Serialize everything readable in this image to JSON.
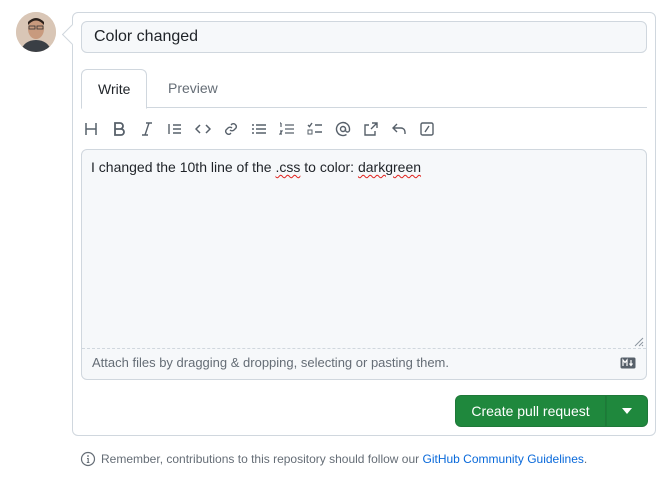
{
  "comment": {
    "title_value": "Color changed",
    "tabs": [
      {
        "label": "Write",
        "active": true
      },
      {
        "label": "Preview",
        "active": false
      }
    ],
    "toolbar_icons": [
      "heading-icon",
      "bold-icon",
      "italic-icon",
      "quote-icon",
      "code-icon",
      "link-icon",
      "unordered-list-icon",
      "ordered-list-icon",
      "task-list-icon",
      "mention-icon",
      "cross-reference-icon",
      "reply-icon",
      "slash-command-icon"
    ],
    "body_parts": {
      "pre": "I changed the 10th line of the ",
      "css": ".css",
      "mid": " to color: ",
      "value": "darkgreen"
    },
    "attach_hint": "Attach files by dragging & dropping, selecting or pasting them."
  },
  "actions": {
    "submit_label": "Create pull request",
    "accent_color": "#1f883d"
  },
  "footer": {
    "text": "Remember, contributions to this repository should follow our ",
    "link_text": "GitHub Community Guidelines",
    "suffix": "."
  }
}
